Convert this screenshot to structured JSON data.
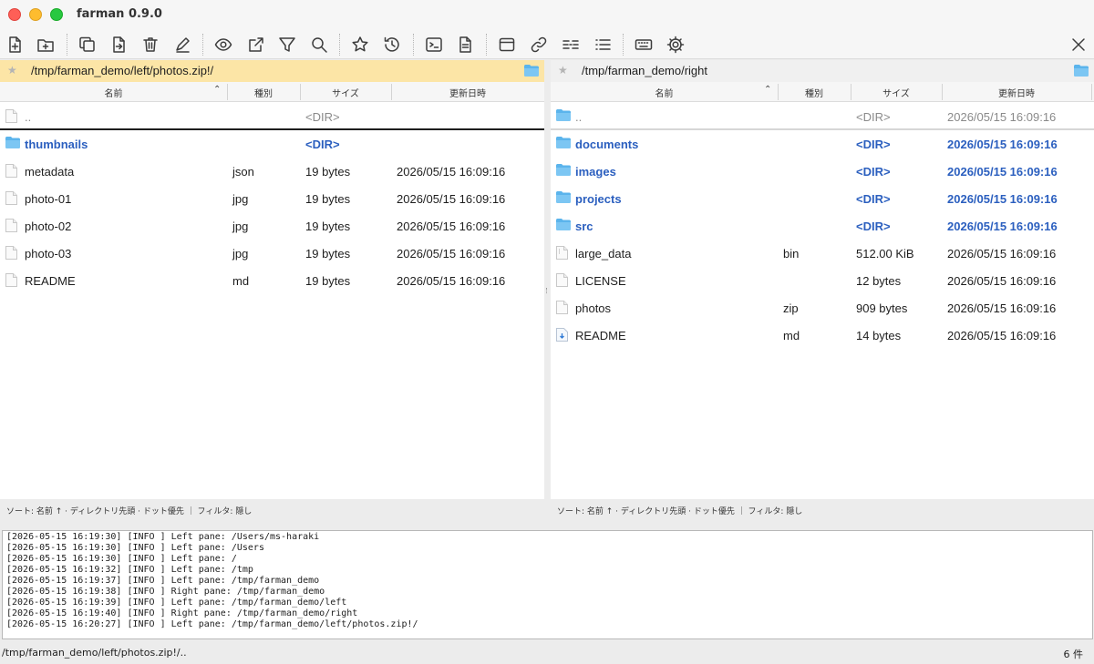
{
  "window": {
    "title": "farman 0.9.0"
  },
  "toolbar": {
    "items": [
      {
        "name": "new-file-icon"
      },
      {
        "name": "new-folder-icon"
      },
      {
        "name": "copy-icon"
      },
      {
        "name": "move-icon"
      },
      {
        "name": "delete-icon"
      },
      {
        "name": "rename-icon"
      },
      {
        "name": "view-icon"
      },
      {
        "name": "open-external-icon"
      },
      {
        "name": "filter-icon"
      },
      {
        "name": "search-icon"
      },
      {
        "name": "bookmark-icon"
      },
      {
        "name": "history-icon"
      },
      {
        "name": "terminal-icon"
      },
      {
        "name": "editor-icon"
      },
      {
        "name": "single-pane-icon"
      },
      {
        "name": "link-icon"
      },
      {
        "name": "compare-icon"
      },
      {
        "name": "list-icon"
      },
      {
        "name": "keyboard-icon"
      },
      {
        "name": "settings-icon"
      },
      {
        "name": "close-icon"
      }
    ]
  },
  "columns": {
    "name": "名前",
    "type": "種別",
    "size": "サイズ",
    "date": "更新日時"
  },
  "left": {
    "path": "/tmp/farman_demo/left/photos.zip!/",
    "rows": [
      {
        "name": "..",
        "type": "",
        "size": "<DIR>",
        "date": "",
        "kind": "parent"
      },
      {
        "name": "thumbnails",
        "type": "",
        "size": "<DIR>",
        "date": "",
        "kind": "dir"
      },
      {
        "name": "metadata",
        "type": "json",
        "size": "19 bytes",
        "date": "2026/05/15 16:09:16",
        "kind": "file"
      },
      {
        "name": "photo-01",
        "type": "jpg",
        "size": "19 bytes",
        "date": "2026/05/15 16:09:16",
        "kind": "file"
      },
      {
        "name": "photo-02",
        "type": "jpg",
        "size": "19 bytes",
        "date": "2026/05/15 16:09:16",
        "kind": "file"
      },
      {
        "name": "photo-03",
        "type": "jpg",
        "size": "19 bytes",
        "date": "2026/05/15 16:09:16",
        "kind": "file"
      },
      {
        "name": "README",
        "type": "md",
        "size": "19 bytes",
        "date": "2026/05/15 16:09:16",
        "kind": "file"
      }
    ],
    "sort_status": "ソート: 名前 ↑ · ディレクトリ先頭 · ドット優先 ｜ フィルタ: 隠し"
  },
  "right": {
    "path": "/tmp/farman_demo/right",
    "rows": [
      {
        "name": "..",
        "type": "",
        "size": "<DIR>",
        "date": "2026/05/15 16:09:16",
        "kind": "parent"
      },
      {
        "name": "documents",
        "type": "",
        "size": "<DIR>",
        "date": "2026/05/15 16:09:16",
        "kind": "dir"
      },
      {
        "name": "images",
        "type": "",
        "size": "<DIR>",
        "date": "2026/05/15 16:09:16",
        "kind": "dir"
      },
      {
        "name": "projects",
        "type": "",
        "size": "<DIR>",
        "date": "2026/05/15 16:09:16",
        "kind": "dir"
      },
      {
        "name": "src",
        "type": "",
        "size": "<DIR>",
        "date": "2026/05/15 16:09:16",
        "kind": "dir"
      },
      {
        "name": "large_data",
        "type": "bin",
        "size": "512.00 KiB",
        "date": "2026/05/15 16:09:16",
        "kind": "file"
      },
      {
        "name": "LICENSE",
        "type": "",
        "size": "12 bytes",
        "date": "2026/05/15 16:09:16",
        "kind": "file"
      },
      {
        "name": "photos",
        "type": "zip",
        "size": "909 bytes",
        "date": "2026/05/15 16:09:16",
        "kind": "file"
      },
      {
        "name": "README",
        "type": "md",
        "size": "14 bytes",
        "date": "2026/05/15 16:09:16",
        "kind": "markdown"
      }
    ],
    "sort_status": "ソート: 名前 ↑ · ディレクトリ先頭 · ドット優先 ｜ フィルタ: 隠し"
  },
  "log": [
    "[2026-05-15 16:19:30] [INFO ] Left pane: /Users/ms-haraki",
    "[2026-05-15 16:19:30] [INFO ] Left pane: /Users",
    "[2026-05-15 16:19:30] [INFO ] Left pane: /",
    "[2026-05-15 16:19:32] [INFO ] Left pane: /tmp",
    "[2026-05-15 16:19:37] [INFO ] Left pane: /tmp/farman_demo",
    "[2026-05-15 16:19:38] [INFO ] Right pane: /tmp/farman_demo",
    "[2026-05-15 16:19:39] [INFO ] Left pane: /tmp/farman_demo/left",
    "[2026-05-15 16:19:40] [INFO ] Right pane: /tmp/farman_demo/right",
    "[2026-05-15 16:20:27] [INFO ] Left pane: /tmp/farman_demo/left/photos.zip!/"
  ],
  "status": {
    "path": "/tmp/farman_demo/left/photos.zip!/..",
    "count": "6 件"
  },
  "colors": {
    "active_path_bg": "#fce5a6",
    "dir_text": "#2b5fbf",
    "folder_icon": "#5bb4ec"
  }
}
